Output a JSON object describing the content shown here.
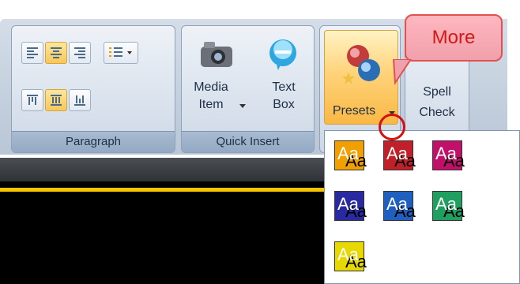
{
  "ribbon": {
    "groups": {
      "paragraph": "Paragraph",
      "quick_insert": "Quick Insert"
    },
    "quick_insert": {
      "media_item": [
        "Media",
        "Item"
      ],
      "text_box": [
        "Text",
        "Box"
      ]
    },
    "presets_label": "Presets",
    "spell_check": [
      "Spell",
      "Check"
    ]
  },
  "callout": {
    "text": "More"
  },
  "presets_menu": {
    "sample_text": "Aa",
    "swatches": [
      {
        "name": "gold",
        "color": "#f0a000"
      },
      {
        "name": "red",
        "color": "#c0202a"
      },
      {
        "name": "magenta",
        "color": "#c0106a"
      },
      {
        "name": "navy",
        "color": "#2a2aa0"
      },
      {
        "name": "blue",
        "color": "#1f5fbf"
      },
      {
        "name": "green",
        "color": "#1fa060"
      },
      {
        "name": "yellow",
        "color": "#e6d800"
      }
    ]
  },
  "colors": {
    "accent_yellow": "#f6c400",
    "callout_border": "#e0524f",
    "callout_text": "#d11a17"
  }
}
